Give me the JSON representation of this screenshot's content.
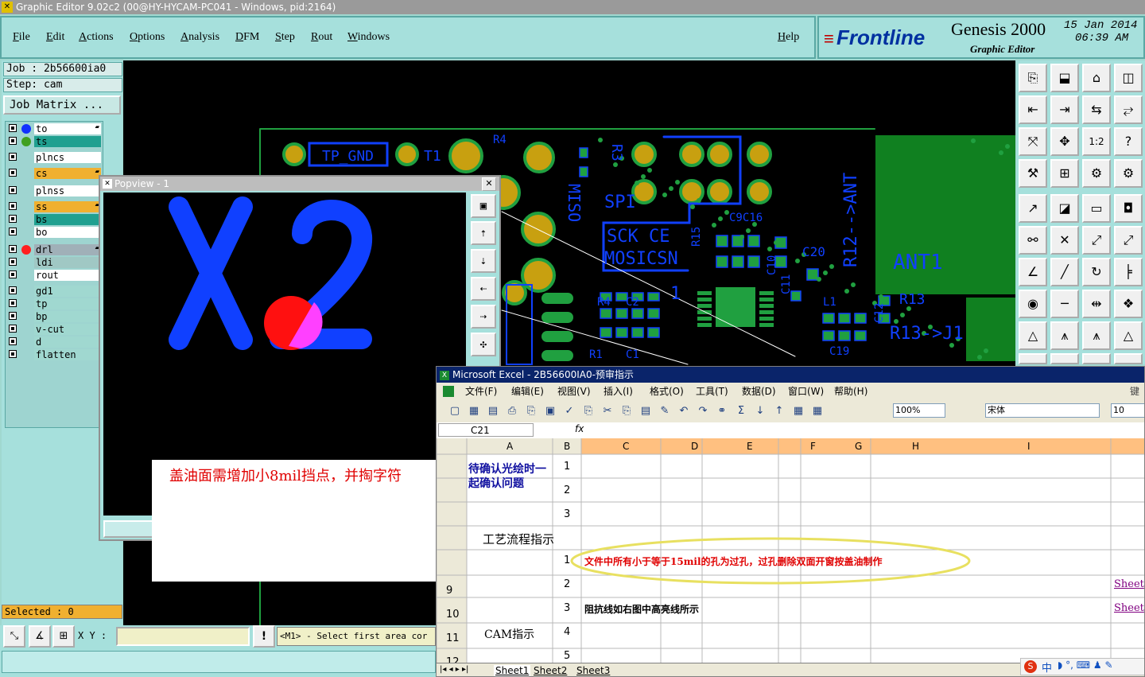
{
  "window": {
    "title": "Graphic Editor 9.02c2 (00@HY-HYCAM-PC041 - Windows, pid:2164)"
  },
  "menu": [
    "File",
    "Edit",
    "Actions",
    "Options",
    "Analysis",
    "DFM",
    "Step",
    "Rout",
    "Windows"
  ],
  "help": "Help",
  "brand": {
    "logo": "Frontline",
    "product": "Genesis 2000",
    "subtitle": "Graphic Editor",
    "date": "15 Jan 2014",
    "time": "06:39 AM"
  },
  "job": {
    "job_label": "Job : 2b56600ia0",
    "step_label": "Step: cam",
    "matrix_button": "Job Matrix ..."
  },
  "layers": [
    {
      "name": "to",
      "bg": "#ffffff",
      "dot": "#1030ff",
      "mark": true
    },
    {
      "name": "ts",
      "bg": "#20a090",
      "dot": "#40a020",
      "mark": false
    },
    {
      "name": "plncs",
      "bg": "#ffffff",
      "dot": "",
      "mark": false
    },
    {
      "name": "cs",
      "bg": "#f0b030",
      "dot": "",
      "mark": true
    },
    {
      "name": "plnss",
      "bg": "#ffffff",
      "dot": "",
      "mark": false
    },
    {
      "name": "ss",
      "bg": "#f0b030",
      "dot": "",
      "mark": true
    },
    {
      "name": "bs",
      "bg": "#20a090",
      "dot": "",
      "mark": false
    },
    {
      "name": "bo",
      "bg": "#ffffff",
      "dot": "",
      "mark": false
    },
    {
      "name": "drl",
      "bg": "#a0b0b8",
      "dot": "#ff2020",
      "mark": true
    },
    {
      "name": "ldi",
      "bg": "#a0c8c4",
      "dot": "",
      "mark": false
    },
    {
      "name": "rout",
      "bg": "#ffffff",
      "dot": "",
      "mark": false
    },
    {
      "name": "gd1",
      "bg": "#a0d8d0",
      "dot": "",
      "mark": false
    },
    {
      "name": "tp",
      "bg": "#a0d8d0",
      "dot": "",
      "mark": false
    },
    {
      "name": "bp",
      "bg": "#a0d8d0",
      "dot": "",
      "mark": false
    },
    {
      "name": "v-cut",
      "bg": "#a0d8d0",
      "dot": "",
      "mark": false
    },
    {
      "name": "d",
      "bg": "#a0d8d0",
      "dot": "",
      "mark": false
    },
    {
      "name": "flatten",
      "bg": "#a0d8d0",
      "dot": "",
      "mark": false
    }
  ],
  "selected_label": "Selected : 0",
  "bottom": {
    "xy_label": "X Y :",
    "xy_value": "",
    "message": "<M1> - Select first area cor"
  },
  "pcb_labels": [
    "TP_GND",
    "T1",
    "R4",
    "R3",
    "MISO",
    "SPI",
    "SCK CE",
    "MOSICSN",
    "R15",
    "C9C16",
    "C20",
    "C10",
    "C11",
    "L1",
    "R12-->ANT",
    "R13",
    "R13->J1",
    "C12",
    "C19",
    "ANT1",
    "R4",
    "C2",
    "R1",
    "C1",
    "1"
  ],
  "popview": {
    "title": "Popview - 1",
    "glyphs": "X2"
  },
  "note_text": "盖油面需增加小8mil挡点，并掏字符",
  "excel": {
    "title": "Microsoft Excel - 2B56600IA0-预审指示",
    "menu": [
      "文件(F)",
      "编辑(E)",
      "视图(V)",
      "插入(I)",
      "格式(O)",
      "工具(T)",
      "数据(D)",
      "窗口(W)",
      "帮助(H)"
    ],
    "menu_right": "键入",
    "zoom": "100%",
    "font": "宋体",
    "font_size": "10",
    "cell_ref": "C21",
    "fx": "fx",
    "columns": [
      "A",
      "B",
      "C",
      "D",
      "E",
      "F",
      "G",
      "H",
      "I"
    ],
    "row_numbers": [
      "9",
      "10",
      "11",
      "12"
    ],
    "confirm_text": "待确认光绘时一起确认问题",
    "confirm_nums": [
      "1",
      "2",
      "3"
    ],
    "process_label": "工艺流程指示",
    "item_1_num": "1",
    "item_1_text": "文件中所有小于等于15mil的孔为过孔，过孔删除双面开窗按盖油制作",
    "item_2_num": "2",
    "item_3_num": "3",
    "item_3_text": "阻抗线如右图中高亮线所示",
    "item_4_num": "4",
    "item_5_num": "5",
    "cam_label": "CAM指示",
    "sheet_link": "Sheet",
    "tabs": [
      "Sheet1",
      "Sheet2",
      "Sheet3"
    ],
    "ime_label": "中"
  }
}
